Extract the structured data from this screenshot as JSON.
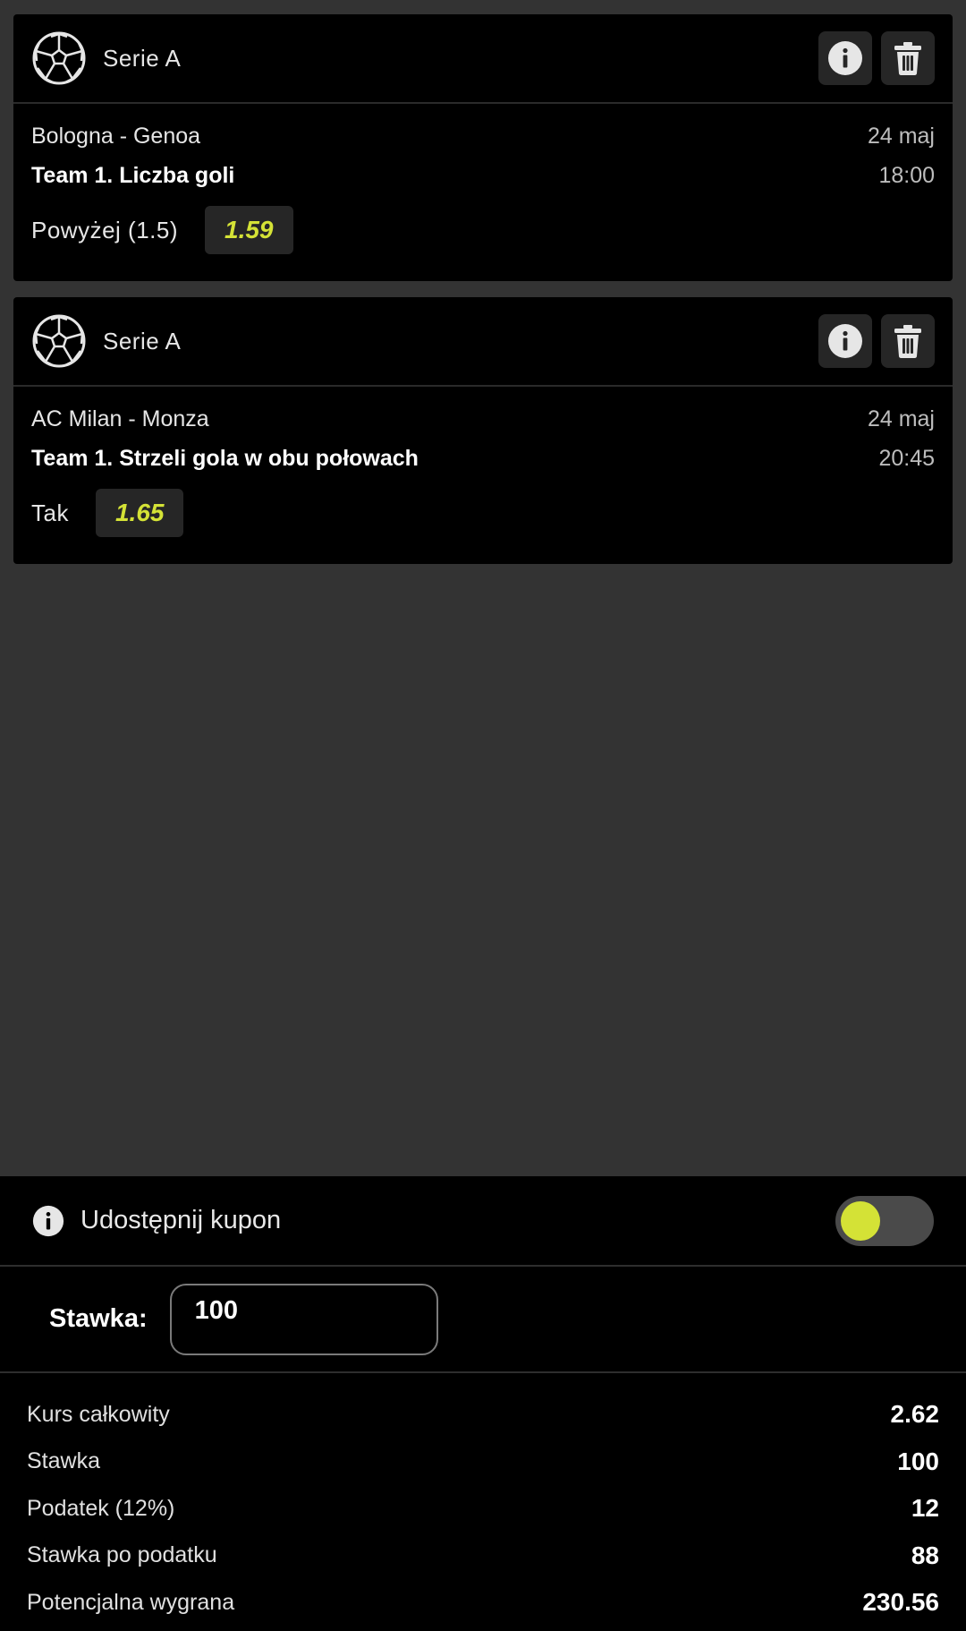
{
  "bets": [
    {
      "league": "Serie A",
      "sport_icon": "soccer-ball-icon",
      "match": "Bologna - Genoa",
      "date": "24 maj",
      "market": "Team 1. Liczba goli",
      "time": "18:00",
      "selection": "Powyżej (1.5)",
      "odds": "1.59"
    },
    {
      "league": "Serie A",
      "sport_icon": "soccer-ball-icon",
      "match": "AC Milan - Monza",
      "date": "24 maj",
      "market": "Team 1. Strzeli gola w obu połowach",
      "time": "20:45",
      "selection": "Tak",
      "odds": "1.65"
    }
  ],
  "share": {
    "label": "Udostępnij kupon",
    "toggle_on": false
  },
  "stake": {
    "label": "Stawka:",
    "value": "100"
  },
  "summary": [
    {
      "label": "Kurs całkowity",
      "value": "2.62"
    },
    {
      "label": "Stawka",
      "value": "100"
    },
    {
      "label": "Podatek (12%)",
      "value": "12"
    },
    {
      "label": "Stawka po podatku",
      "value": "88"
    },
    {
      "label": "Potencjalna wygrana",
      "value": "230.56"
    }
  ],
  "colors": {
    "accent": "#d4e236",
    "background": "#333333",
    "panel": "#000000"
  }
}
